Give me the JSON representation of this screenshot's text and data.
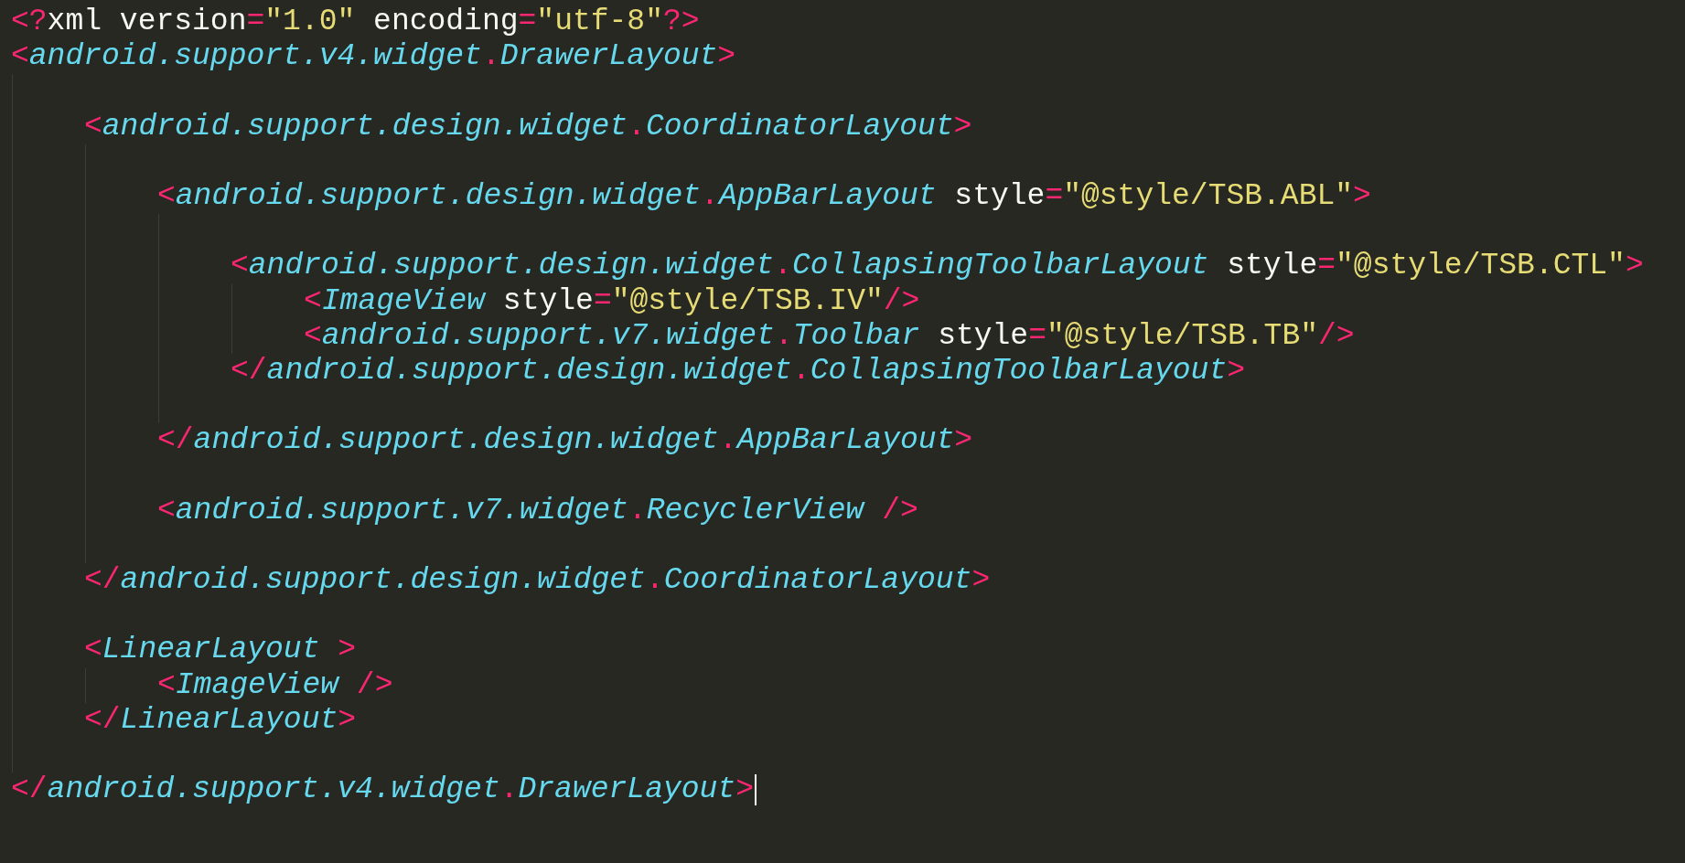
{
  "editor": {
    "items": [
      {
        "kind": "line",
        "tokens": [
          {
            "kind": "punct",
            "text": "<?"
          },
          {
            "kind": "plain",
            "text": "xml version"
          },
          {
            "kind": "punct",
            "text": "="
          },
          {
            "kind": "string",
            "text": "\"1.0\""
          },
          {
            "kind": "plain",
            "text": " encoding"
          },
          {
            "kind": "punct",
            "text": "="
          },
          {
            "kind": "string",
            "text": "\"utf-8\""
          },
          {
            "kind": "punct",
            "text": "?>"
          }
        ]
      },
      {
        "kind": "element",
        "open": [
          {
            "kind": "punct",
            "text": "<"
          },
          {
            "kind": "tag",
            "text": "android.support.v4.widget"
          },
          {
            "kind": "punct",
            "text": "."
          },
          {
            "kind": "tag",
            "text": "DrawerLayout"
          },
          {
            "kind": "punct",
            "text": ">"
          }
        ],
        "children": [
          {
            "kind": "blank"
          },
          {
            "kind": "element",
            "open": [
              {
                "kind": "punct",
                "text": "<"
              },
              {
                "kind": "tag",
                "text": "android.support.design.widget"
              },
              {
                "kind": "punct",
                "text": "."
              },
              {
                "kind": "tag",
                "text": "CoordinatorLayout"
              },
              {
                "kind": "punct",
                "text": ">"
              }
            ],
            "children": [
              {
                "kind": "blank"
              },
              {
                "kind": "element",
                "open": [
                  {
                    "kind": "punct",
                    "text": "<"
                  },
                  {
                    "kind": "tag",
                    "text": "android.support.design.widget"
                  },
                  {
                    "kind": "punct",
                    "text": "."
                  },
                  {
                    "kind": "tag",
                    "text": "AppBarLayout"
                  },
                  {
                    "kind": "plain",
                    "text": " style"
                  },
                  {
                    "kind": "punct",
                    "text": "="
                  },
                  {
                    "kind": "string",
                    "text": "\"@style/TSB.ABL\""
                  },
                  {
                    "kind": "punct",
                    "text": ">"
                  }
                ],
                "children": [
                  {
                    "kind": "blank"
                  },
                  {
                    "kind": "element",
                    "open": [
                      {
                        "kind": "punct",
                        "text": "<"
                      },
                      {
                        "kind": "tag",
                        "text": "android.support.design.widget"
                      },
                      {
                        "kind": "punct",
                        "text": "."
                      },
                      {
                        "kind": "tag",
                        "text": "CollapsingToolbarLayout"
                      },
                      {
                        "kind": "plain",
                        "text": " style"
                      },
                      {
                        "kind": "punct",
                        "text": "="
                      },
                      {
                        "kind": "string",
                        "text": "\"@style/TSB.CTL\""
                      },
                      {
                        "kind": "punct",
                        "text": ">"
                      }
                    ],
                    "children": [
                      {
                        "kind": "line",
                        "tokens": [
                          {
                            "kind": "punct",
                            "text": "<"
                          },
                          {
                            "kind": "tag",
                            "text": "ImageView"
                          },
                          {
                            "kind": "plain",
                            "text": " style"
                          },
                          {
                            "kind": "punct",
                            "text": "="
                          },
                          {
                            "kind": "string",
                            "text": "\"@style/TSB.IV\""
                          },
                          {
                            "kind": "punct",
                            "text": "/>"
                          }
                        ]
                      },
                      {
                        "kind": "line",
                        "tokens": [
                          {
                            "kind": "punct",
                            "text": "<"
                          },
                          {
                            "kind": "tag",
                            "text": "android.support.v7.widget"
                          },
                          {
                            "kind": "punct",
                            "text": "."
                          },
                          {
                            "kind": "tag",
                            "text": "Toolbar"
                          },
                          {
                            "kind": "plain",
                            "text": " style"
                          },
                          {
                            "kind": "punct",
                            "text": "="
                          },
                          {
                            "kind": "string",
                            "text": "\"@style/TSB.TB\""
                          },
                          {
                            "kind": "punct",
                            "text": "/>"
                          }
                        ]
                      }
                    ],
                    "close": [
                      {
                        "kind": "punct",
                        "text": "</"
                      },
                      {
                        "kind": "tag",
                        "text": "android.support.design.widget"
                      },
                      {
                        "kind": "punct",
                        "text": "."
                      },
                      {
                        "kind": "tag",
                        "text": "CollapsingToolbarLayout"
                      },
                      {
                        "kind": "punct",
                        "text": ">"
                      }
                    ]
                  },
                  {
                    "kind": "blank"
                  }
                ],
                "close": [
                  {
                    "kind": "punct",
                    "text": "</"
                  },
                  {
                    "kind": "tag",
                    "text": "android.support.design.widget"
                  },
                  {
                    "kind": "punct",
                    "text": "."
                  },
                  {
                    "kind": "tag",
                    "text": "AppBarLayout"
                  },
                  {
                    "kind": "punct",
                    "text": ">"
                  }
                ]
              },
              {
                "kind": "blank"
              },
              {
                "kind": "line",
                "tokens": [
                  {
                    "kind": "punct",
                    "text": "<"
                  },
                  {
                    "kind": "tag",
                    "text": "android.support.v7.widget"
                  },
                  {
                    "kind": "punct",
                    "text": "."
                  },
                  {
                    "kind": "tag",
                    "text": "RecyclerView"
                  },
                  {
                    "kind": "punct",
                    "text": " />"
                  }
                ]
              },
              {
                "kind": "blank"
              }
            ],
            "close": [
              {
                "kind": "punct",
                "text": "</"
              },
              {
                "kind": "tag",
                "text": "android.support.design.widget"
              },
              {
                "kind": "punct",
                "text": "."
              },
              {
                "kind": "tag",
                "text": "CoordinatorLayout"
              },
              {
                "kind": "punct",
                "text": ">"
              }
            ]
          },
          {
            "kind": "blank"
          },
          {
            "kind": "element",
            "open": [
              {
                "kind": "punct",
                "text": "<"
              },
              {
                "kind": "tag",
                "text": "LinearLayout"
              },
              {
                "kind": "punct",
                "text": " >"
              }
            ],
            "children": [
              {
                "kind": "line",
                "tokens": [
                  {
                    "kind": "punct",
                    "text": "<"
                  },
                  {
                    "kind": "tag",
                    "text": "ImageView"
                  },
                  {
                    "kind": "punct",
                    "text": " />"
                  }
                ]
              }
            ],
            "close": [
              {
                "kind": "punct",
                "text": "</"
              },
              {
                "kind": "tag",
                "text": "LinearLayout"
              },
              {
                "kind": "punct",
                "text": ">"
              }
            ]
          },
          {
            "kind": "blank"
          }
        ],
        "close": [
          {
            "kind": "punct",
            "text": "</"
          },
          {
            "kind": "tag",
            "text": "android.support.v4.widget"
          },
          {
            "kind": "punct",
            "text": "."
          },
          {
            "kind": "tag",
            "text": "DrawerLayout"
          },
          {
            "kind": "punct",
            "text": ">"
          }
        ],
        "cursor": true
      }
    ]
  }
}
